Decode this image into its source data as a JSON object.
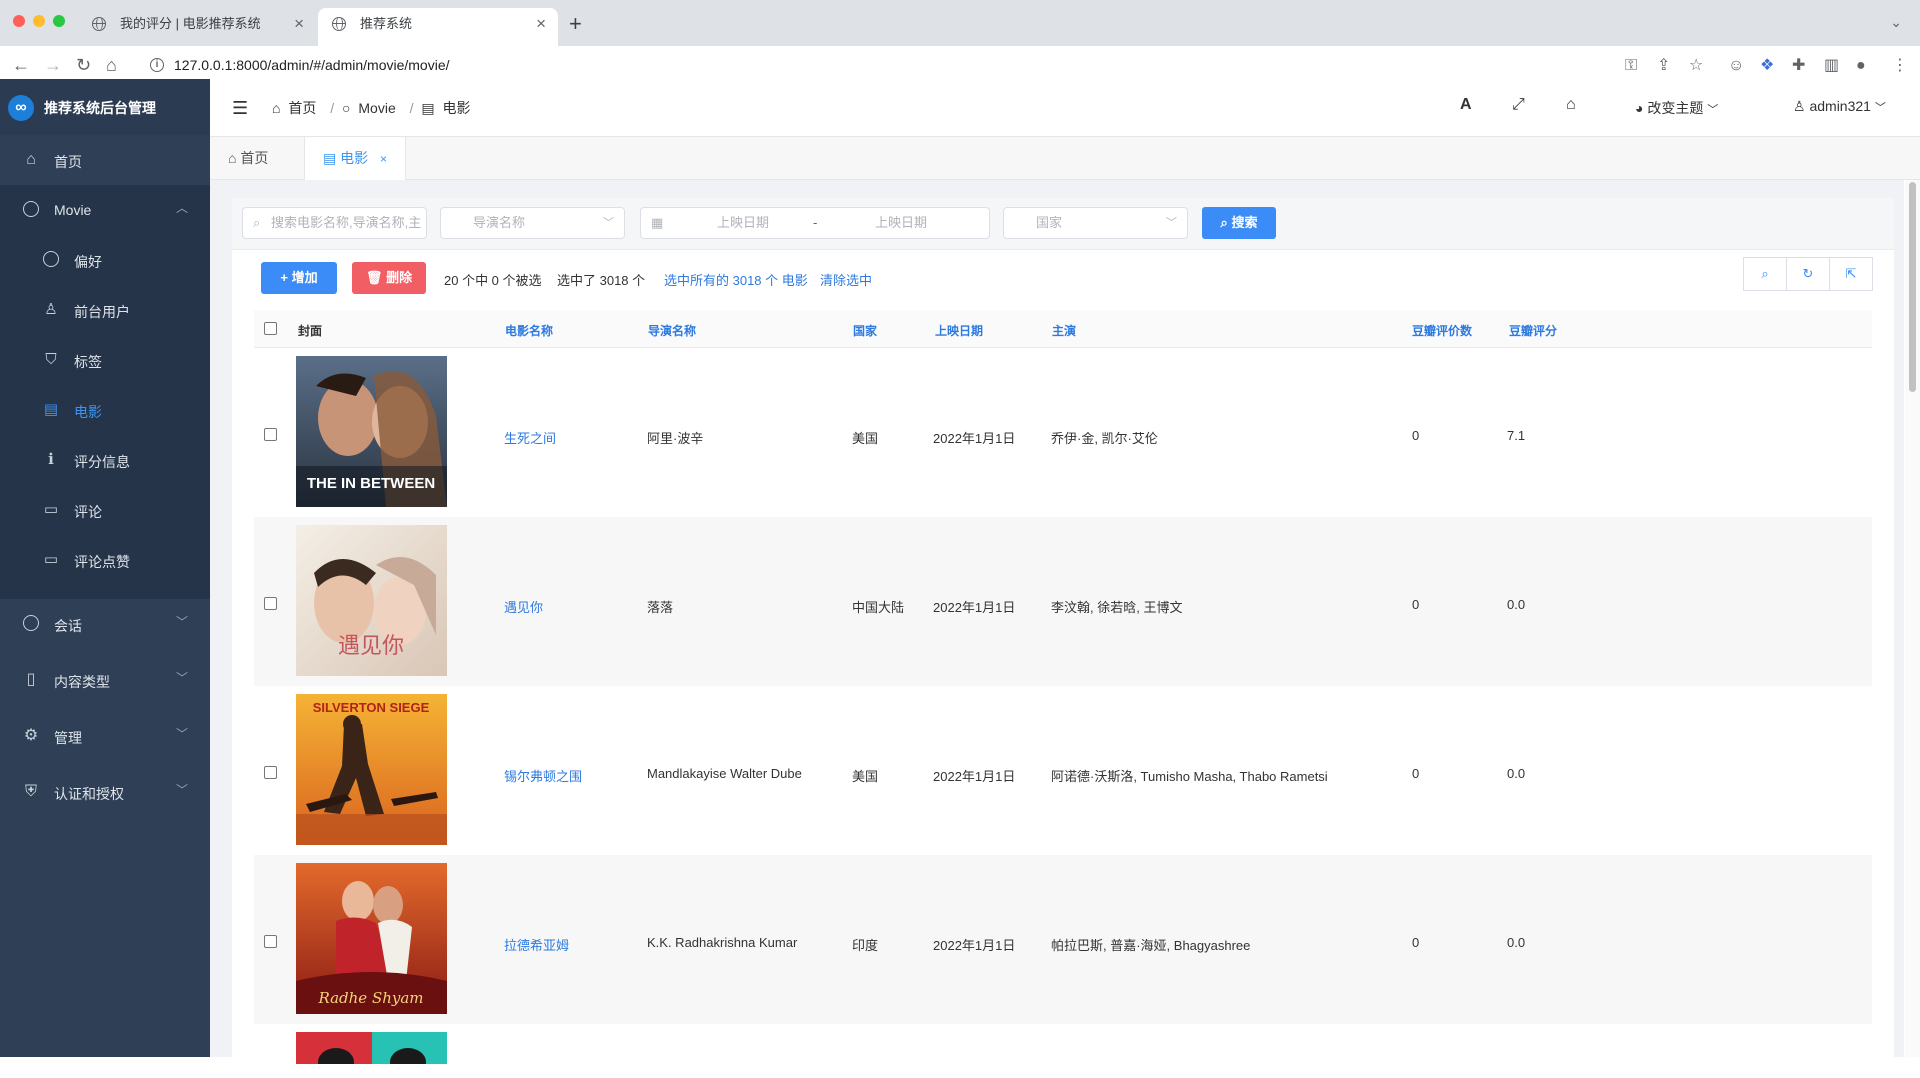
{
  "browser": {
    "tabs": [
      {
        "title": "我的评分 | 电影推荐系统",
        "active": false
      },
      {
        "title": "推荐系统",
        "active": true
      }
    ],
    "url": "127.0.0.1:8000/admin/#/admin/movie/movie/"
  },
  "sidebar": {
    "brand": "推荐系统后台管理",
    "items": [
      {
        "label": "首页",
        "icon": "home-icon"
      },
      {
        "label": "Movie",
        "icon": "circle-icon"
      },
      {
        "label": "偏好",
        "icon": "circle-icon"
      },
      {
        "label": "前台用户",
        "icon": "user-icon"
      },
      {
        "label": "标签",
        "icon": "tags-icon"
      },
      {
        "label": "电影",
        "icon": "film-icon"
      },
      {
        "label": "评分信息",
        "icon": "info-icon"
      },
      {
        "label": "评论",
        "icon": "comment-icon"
      },
      {
        "label": "评论点赞",
        "icon": "comment-icon"
      },
      {
        "label": "会话",
        "icon": "circle-icon"
      },
      {
        "label": "内容类型",
        "icon": "file-icon"
      },
      {
        "label": "管理",
        "icon": "gear-icon"
      },
      {
        "label": "认证和授权",
        "icon": "shield-icon"
      }
    ],
    "active_item": "电影"
  },
  "header": {
    "breadcrumb": [
      "首页",
      "Movie",
      "电影"
    ],
    "theme_label": "改变主题",
    "user": "admin321"
  },
  "page_tabs": [
    {
      "label": "首页",
      "active": false
    },
    {
      "label": "电影",
      "active": true
    }
  ],
  "filters": {
    "search_placeholder": "搜索电影名称,导演名称,主",
    "director_placeholder": "导演名称",
    "date_start_placeholder": "上映日期",
    "date_sep": "-",
    "date_end_placeholder": "上映日期",
    "country_placeholder": "国家",
    "search_label": "搜索"
  },
  "actions": {
    "add_label": "增加",
    "delete_label": "删除",
    "selected_text": "20 个中 0 个被选",
    "selected_count_text": "选中了 3018 个",
    "select_all_link": "选中所有的 3018 个 电影",
    "clear_link": "清除选中"
  },
  "table": {
    "columns": [
      "封面",
      "电影名称",
      "导演名称",
      "国家",
      "上映日期",
      "主演",
      "豆瓣评价数",
      "豆瓣评分"
    ],
    "rows": [
      {
        "name": "生死之间",
        "director": "阿里·波辛",
        "country": "美国",
        "date": "2022年1月1日",
        "cast": "乔伊·金, 凯尔·艾伦",
        "votes": "0",
        "rating": "7.1"
      },
      {
        "name": "遇见你",
        "director": "落落",
        "country": "中国大陆",
        "date": "2022年1月1日",
        "cast": "李汶翰, 徐若晗, 王博文",
        "votes": "0",
        "rating": "0.0"
      },
      {
        "name": "锡尔弗顿之围",
        "director": "Mandlakayise Walter Dube",
        "country": "美国",
        "date": "2022年1月1日",
        "cast": "阿诺德·沃斯洛, Tumisho Masha, Thabo Rametsi",
        "votes": "0",
        "rating": "0.0"
      },
      {
        "name": "拉德希亚姆",
        "director": "K.K. Radhakrishna Kumar",
        "country": "印度",
        "date": "2022年1月1日",
        "cast": "帕拉巴斯, 普嘉·海娅, Bhagyashree",
        "votes": "0",
        "rating": "0.0"
      }
    ]
  },
  "posters": [
    {
      "title_text": "THE IN BETWEEN"
    },
    {
      "title_text": "遇见你"
    },
    {
      "title_text": "SILVERTON SIEGE"
    },
    {
      "title_text": "Radhe Shyam"
    }
  ],
  "colors": {
    "accent": "#3b8cf7",
    "danger": "#f15e63",
    "sidebar": "#2e3f56",
    "link": "#2d7ae0"
  }
}
